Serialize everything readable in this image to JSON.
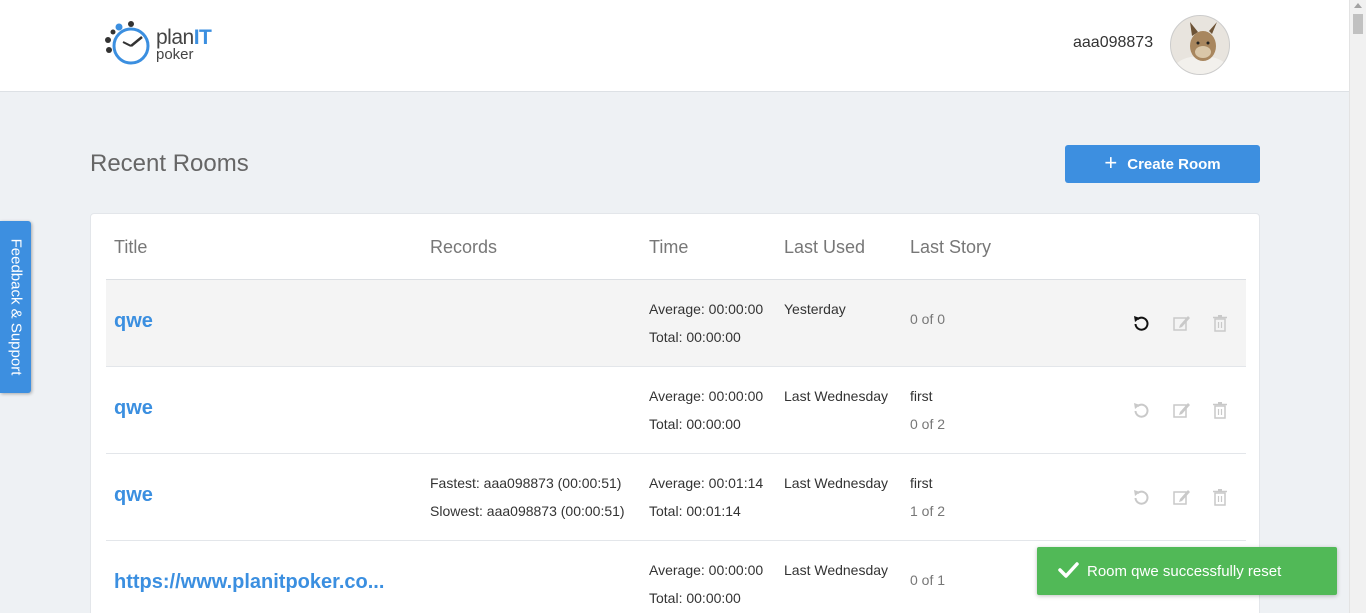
{
  "header": {
    "logo_plan": "plan",
    "logo_it": "IT",
    "logo_poker": "poker",
    "username": "aaa098873"
  },
  "page": {
    "title": "Recent Rooms",
    "create_button": "Create Room",
    "feedback_tab": "Feedback & Support"
  },
  "table": {
    "columns": [
      "Title",
      "Records",
      "Time",
      "Last Used",
      "Last Story"
    ],
    "rows": [
      {
        "title": "qwe",
        "records": [
          "",
          ""
        ],
        "time": [
          "Average: 00:00:00",
          "Total: 00:00:00"
        ],
        "last_used": "Yesterday",
        "story_name": "",
        "story_progress": "0 of 0"
      },
      {
        "title": "qwe",
        "records": [
          "",
          ""
        ],
        "time": [
          "Average: 00:00:00",
          "Total: 00:00:00"
        ],
        "last_used": "Last Wednesday",
        "story_name": "first",
        "story_progress": "0 of 2"
      },
      {
        "title": "qwe",
        "records": [
          "Fastest: aaa098873 (00:00:51)",
          "Slowest: aaa098873 (00:00:51)"
        ],
        "time": [
          "Average: 00:01:14",
          "Total: 00:01:14"
        ],
        "last_used": "Last Wednesday",
        "story_name": "first",
        "story_progress": "1 of 2"
      },
      {
        "title": "https://www.planitpoker.co...",
        "records": [
          "",
          ""
        ],
        "time": [
          "Average: 00:00:00",
          "Total: 00:00:00"
        ],
        "last_used": "Last Wednesday",
        "story_name": "",
        "story_progress": "0 of 1"
      }
    ]
  },
  "toast": {
    "message": "Room qwe successfully reset"
  },
  "colors": {
    "accent": "#3d8fe0",
    "success": "#51b957",
    "icon_active": "#111111",
    "icon_muted": "#c9c9c9"
  },
  "icons": [
    "reset-icon",
    "edit-icon",
    "trash-icon",
    "plus-icon",
    "check-icon"
  ]
}
